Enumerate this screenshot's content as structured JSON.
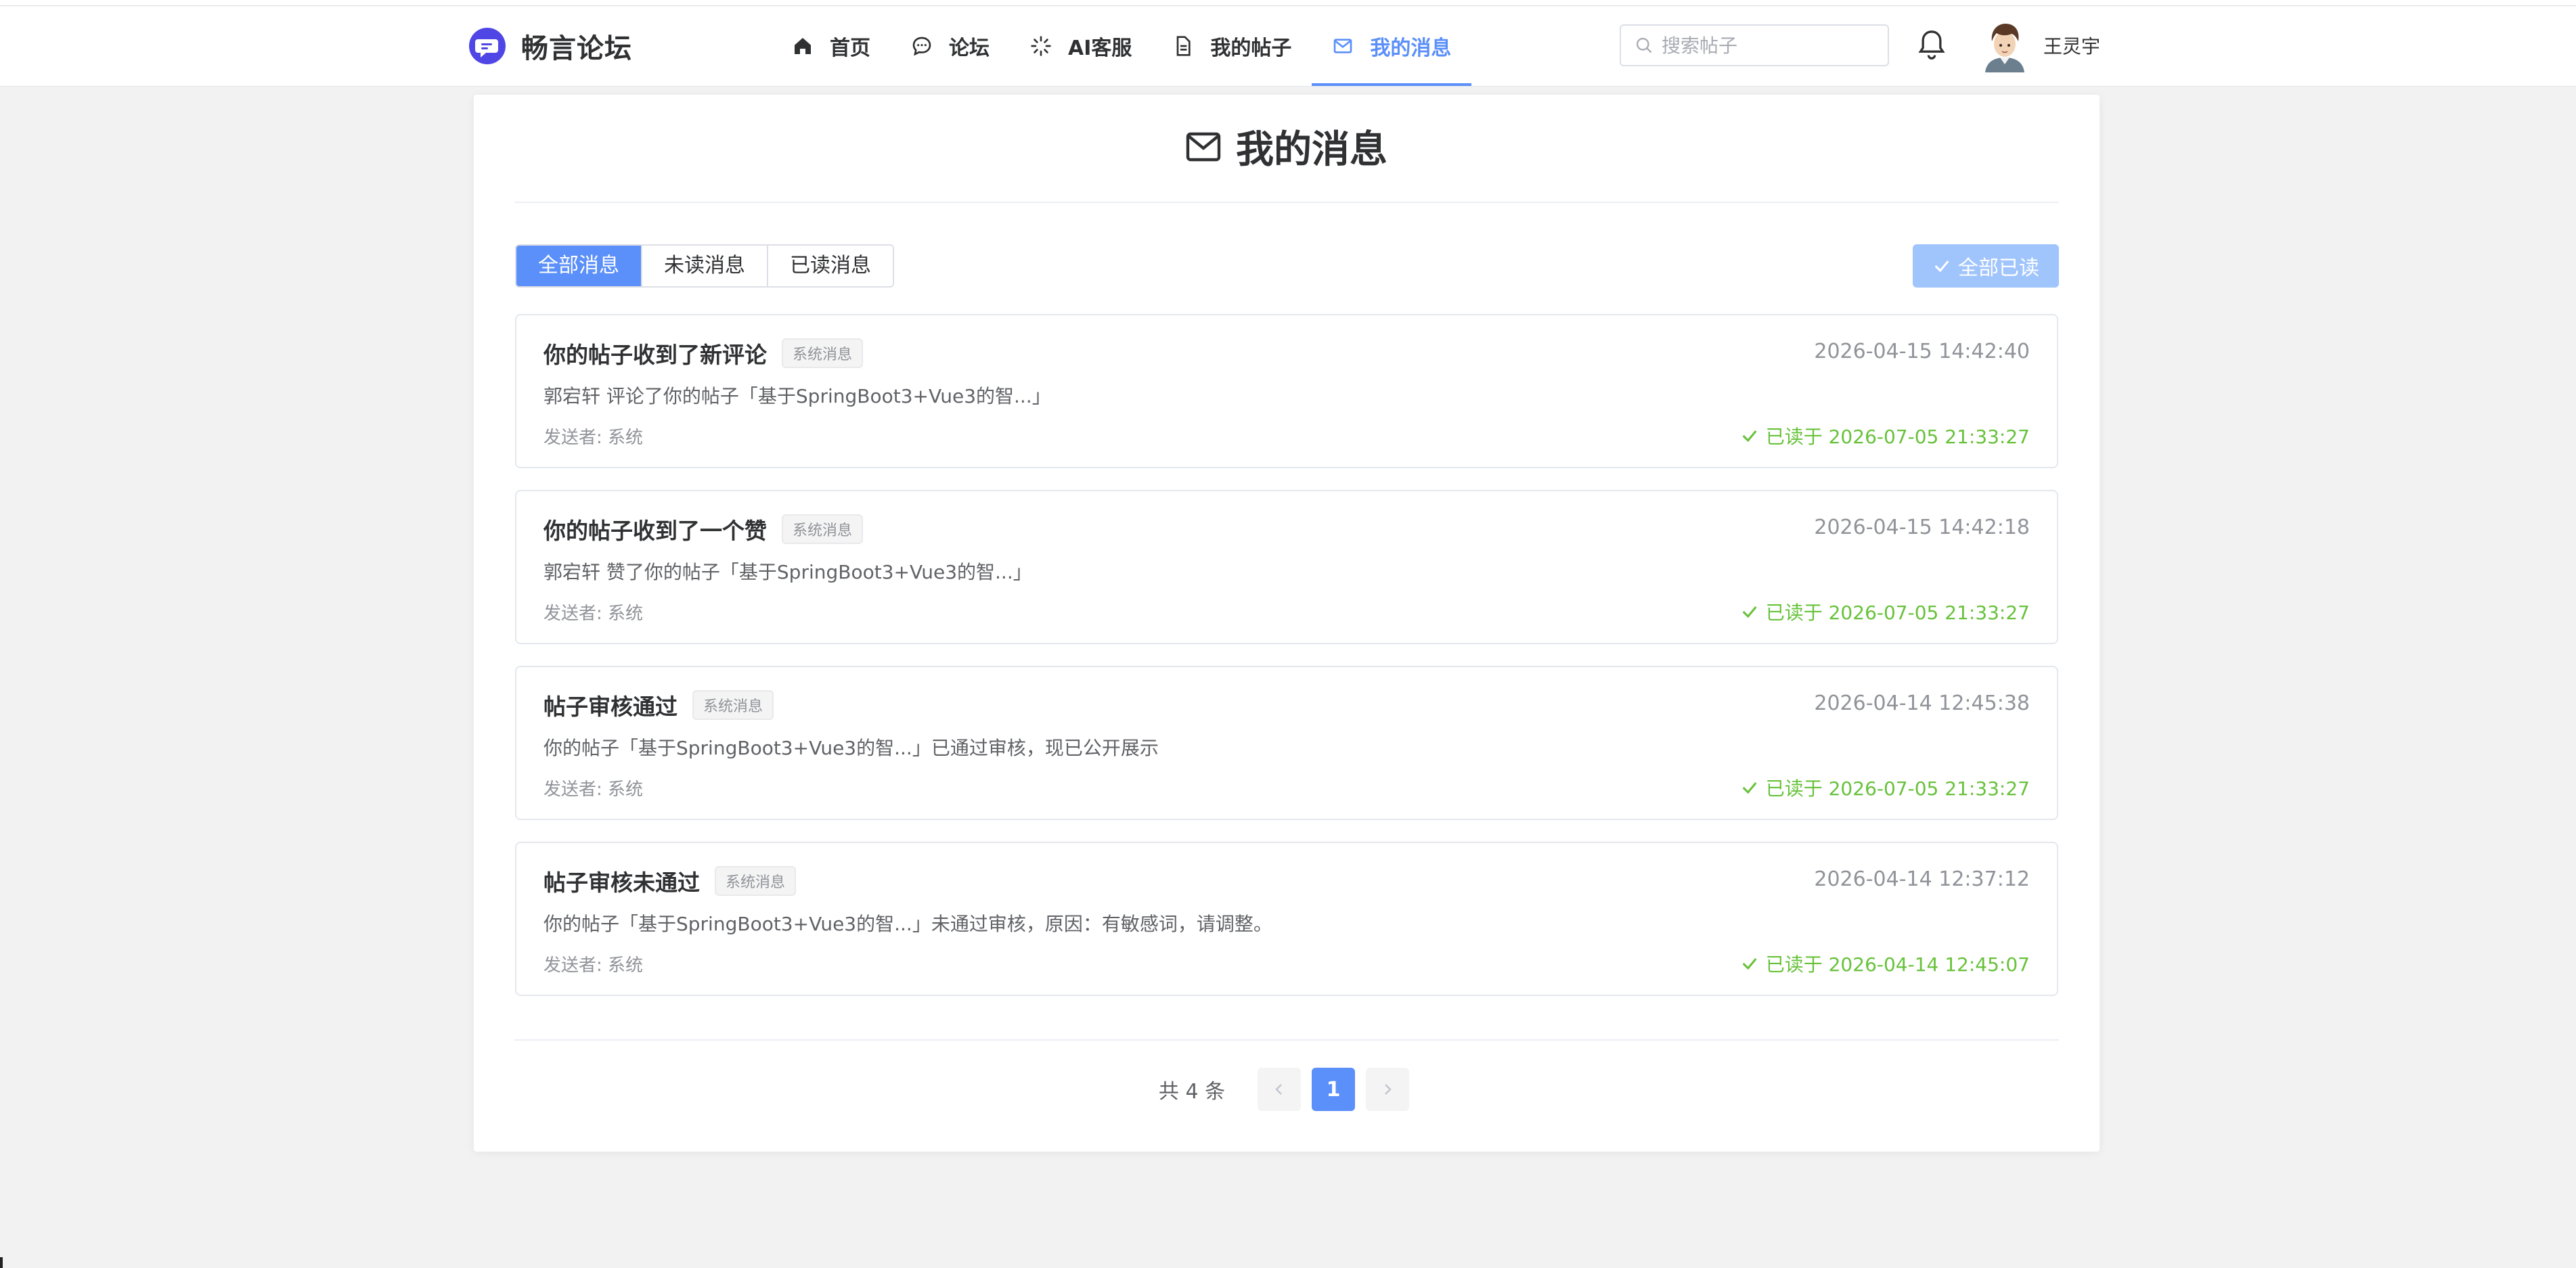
{
  "app": {
    "name": "畅言论坛"
  },
  "nav": {
    "items": [
      {
        "label": "首页",
        "icon": "home-icon"
      },
      {
        "label": "论坛",
        "icon": "chat-bubble-icon"
      },
      {
        "label": "AI客服",
        "icon": "spinner-icon"
      },
      {
        "label": "我的帖子",
        "icon": "document-icon"
      },
      {
        "label": "我的消息",
        "icon": "mail-icon",
        "active": true
      }
    ]
  },
  "search": {
    "placeholder": "搜索帖子",
    "value": ""
  },
  "user": {
    "name": "王灵宇"
  },
  "page": {
    "title": "我的消息"
  },
  "filters": {
    "tabs": [
      {
        "label": "全部消息",
        "active": true
      },
      {
        "label": "未读消息",
        "active": false
      },
      {
        "label": "已读消息",
        "active": false
      }
    ],
    "mark_all_label": "全部已读"
  },
  "messages": [
    {
      "title": "你的帖子收到了新评论",
      "badge": "系统消息",
      "time": "2026-04-15 14:42:40",
      "content": "郭宕轩 评论了你的帖子「基于SpringBoot3+Vue3的智...」",
      "sender": "发送者: 系统",
      "read_status": "已读于 2026-07-05 21:33:27"
    },
    {
      "title": "你的帖子收到了一个赞",
      "badge": "系统消息",
      "time": "2026-04-15 14:42:18",
      "content": "郭宕轩 赞了你的帖子「基于SpringBoot3+Vue3的智...」",
      "sender": "发送者: 系统",
      "read_status": "已读于 2026-07-05 21:33:27"
    },
    {
      "title": "帖子审核通过",
      "badge": "系统消息",
      "time": "2026-04-14 12:45:38",
      "content": "你的帖子「基于SpringBoot3+Vue3的智...」已通过审核，现已公开展示",
      "sender": "发送者: 系统",
      "read_status": "已读于 2026-07-05 21:33:27"
    },
    {
      "title": "帖子审核未通过",
      "badge": "系统消息",
      "time": "2026-04-14 12:37:12",
      "content": "你的帖子「基于SpringBoot3+Vue3的智...」未通过审核，原因：有敏感词，请调整。",
      "sender": "发送者: 系统",
      "read_status": "已读于 2026-04-14 12:45:07"
    }
  ],
  "pagination": {
    "total_label": "共 4 条",
    "current_page": "1"
  },
  "colors": {
    "accent": "#5b8ff9",
    "read_green": "#67c23a",
    "muted": "#909399"
  }
}
